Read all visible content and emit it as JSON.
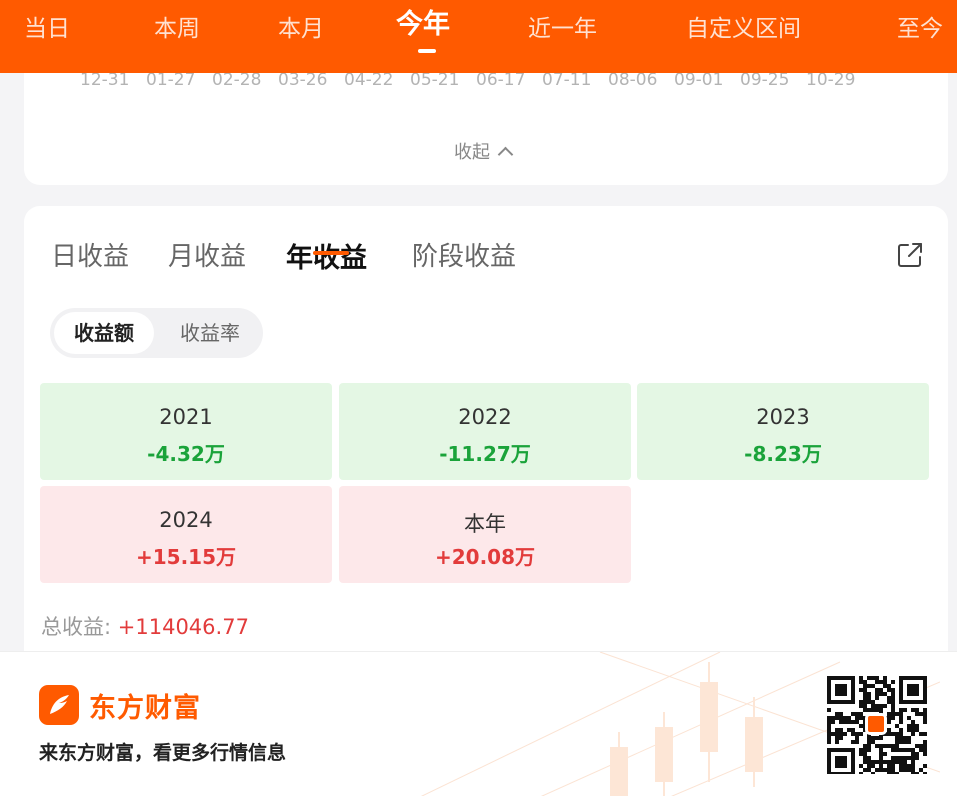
{
  "period_tabs": [
    {
      "label": "当日"
    },
    {
      "label": "本周"
    },
    {
      "label": "本月"
    },
    {
      "label": "今年",
      "active": true
    },
    {
      "label": "近一年"
    },
    {
      "label": "自定义区间"
    },
    {
      "label": "至今"
    }
  ],
  "chart_card": {
    "date_ticks": [
      "12-31",
      "01-27",
      "02-28",
      "03-26",
      "04-22",
      "05-21",
      "06-17",
      "07-11",
      "08-06",
      "09-01",
      "09-25",
      "10-29"
    ],
    "collapse_label": "收起"
  },
  "profit_card": {
    "tabs": [
      {
        "label": "日收益"
      },
      {
        "label": "月收益"
      },
      {
        "label": "年收益",
        "active": true
      },
      {
        "label": "阶段收益"
      }
    ],
    "share_icon": "share-icon",
    "segment": {
      "active": "收益额",
      "inactive": "收益率"
    },
    "years": [
      {
        "year": "2021",
        "amount": "-4.32万",
        "status": "loss"
      },
      {
        "year": "2022",
        "amount": "-11.27万",
        "status": "loss"
      },
      {
        "year": "2023",
        "amount": "-8.23万",
        "status": "loss"
      },
      {
        "year": "2024",
        "amount": "+15.15万",
        "status": "gain"
      },
      {
        "year": "本年",
        "amount": "+20.08万",
        "status": "gain"
      }
    ],
    "total_label": "总收益: ",
    "total_value": "+114046.77"
  },
  "footer": {
    "brand_name": "东方财富",
    "slogan": "来东方财富，看更多行情信息"
  },
  "colors": {
    "brand": "#ff5a00",
    "gain": "#e23b3b",
    "loss": "#1aa33a",
    "gain_bg": "#fde8ea",
    "loss_bg": "#e4f7e4"
  }
}
